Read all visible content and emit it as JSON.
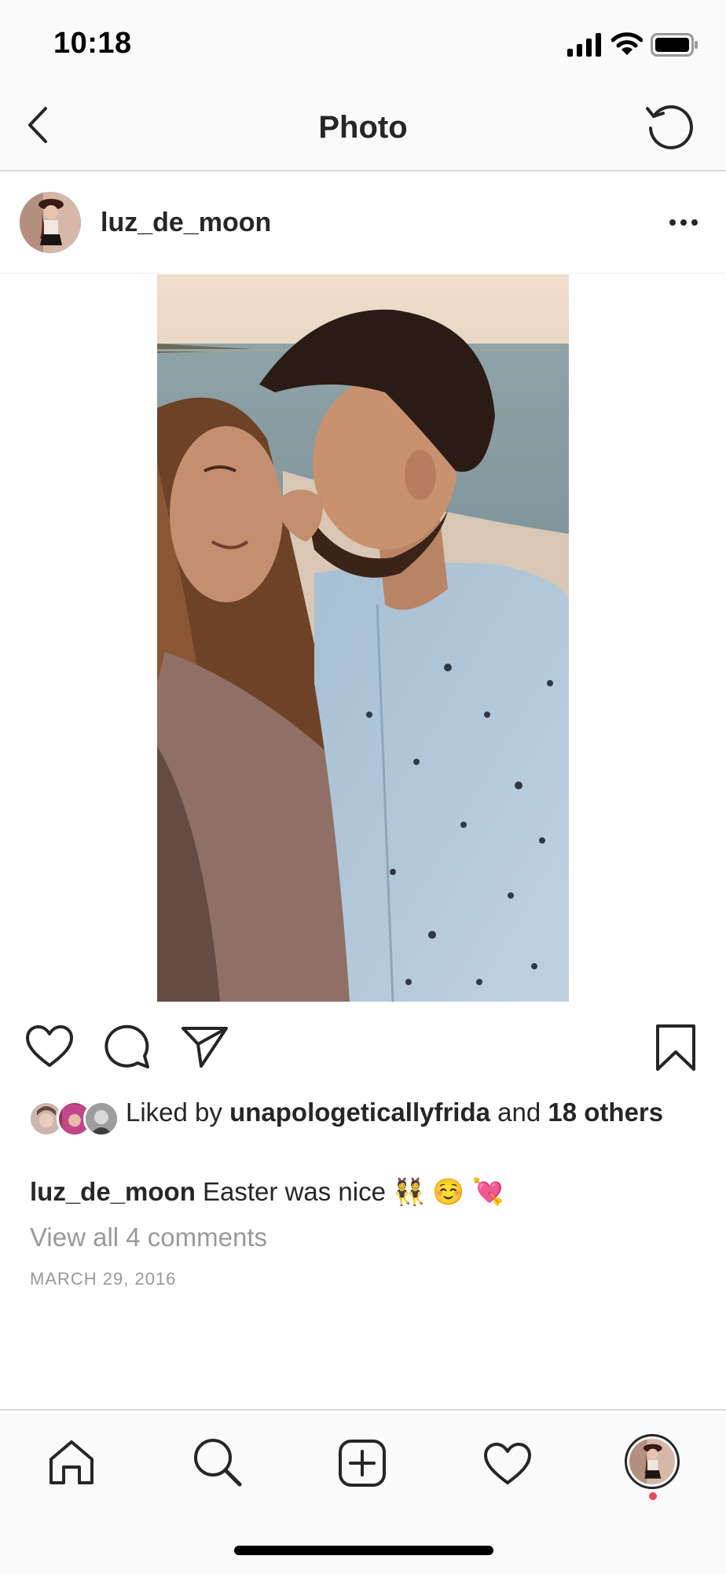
{
  "status_bar": {
    "time": "10:18",
    "icons": [
      "cellular-signal-icon",
      "wifi-icon",
      "battery-icon"
    ]
  },
  "nav": {
    "title": "Photo",
    "back_icon": "chevron-left-icon",
    "refresh_icon": "refresh-icon"
  },
  "post": {
    "username": "luz_de_moon",
    "more_icon": "ellipsis-icon",
    "image_description": "photo",
    "actions": [
      "heart-icon",
      "comment-icon",
      "send-icon",
      "bookmark-icon"
    ],
    "likes": {
      "prefix": "Liked by ",
      "user": "unapologeticallyfrida",
      "middle": " and ",
      "count": "18 others"
    },
    "caption": {
      "user": "luz_de_moon",
      "text": " Easter was nice 👯 ☺️ 💘"
    },
    "view_comments": "View all 4 comments",
    "date": "MARCH 29, 2016"
  },
  "tabbar": {
    "items": [
      "home-icon",
      "search-icon",
      "add-post-icon",
      "activity-heart-icon",
      "profile-avatar"
    ]
  },
  "colors": {
    "text": "#262626",
    "secondary": "#999999",
    "divider": "#dbdbdb",
    "notification_dot": "#ed4956"
  }
}
